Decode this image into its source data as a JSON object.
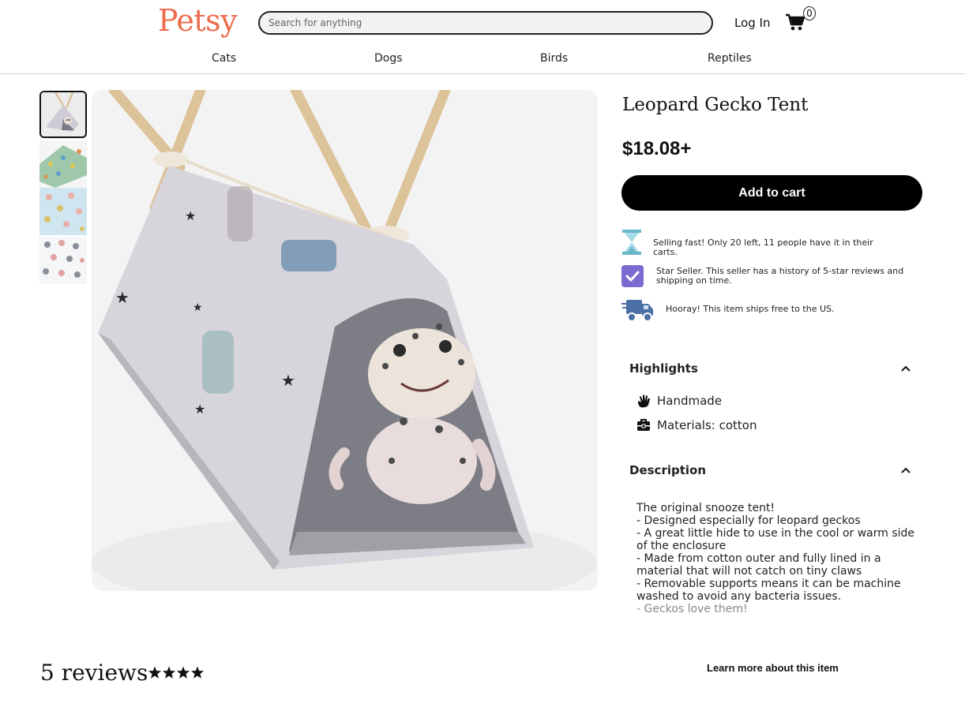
{
  "header": {
    "logo": "Petsy",
    "search_placeholder": "Search for anything",
    "login_label": "Log In",
    "cart_count": "0"
  },
  "nav": {
    "items": [
      {
        "label": "Cats"
      },
      {
        "label": "Dogs"
      },
      {
        "label": "Birds"
      },
      {
        "label": "Reptiles"
      }
    ]
  },
  "gallery": {
    "selected_index": 0,
    "thumbnail_count": 4
  },
  "product": {
    "title": "Leopard Gecko Tent",
    "price": "$18.08+",
    "add_to_cart_label": "Add to cart",
    "perks": [
      {
        "icon": "hourglass-icon",
        "text": "Selling fast! Only 20 left, 11 people have it in their carts."
      },
      {
        "icon": "checkmark-badge-icon",
        "text": "Star Seller. This seller has a history of 5-star reviews and shipping on time."
      },
      {
        "icon": "delivery-truck-icon",
        "text": "Hooray! This item ships free to the US."
      }
    ]
  },
  "highlights": {
    "heading": "Highlights",
    "items": [
      {
        "icon": "hand-icon",
        "text": "Handmade"
      },
      {
        "icon": "toolbox-icon",
        "text": "Materials: cotton"
      }
    ]
  },
  "description": {
    "heading": "Description",
    "lines": [
      "The original snooze tent!",
      "- Designed especially for leopard geckos",
      "- A great little hide to use in the cool or warm side of the enclosure",
      "- Made from cotton outer and fully lined in a material that will not catch on tiny claws",
      "- Removable supports means it can be machine washed to avoid any bacteria issues.",
      "- Geckos love them!"
    ]
  },
  "reviews": {
    "count_label": "5 reviews",
    "stars": 4
  },
  "learn_more_label": "Learn more about this item",
  "colors": {
    "logo": "#ee6a4c",
    "button_bg": "#000000",
    "hourglass": "#6ab7c9",
    "star_seller_badge": "#7a6bd0",
    "truck": "#4a6fa5"
  }
}
